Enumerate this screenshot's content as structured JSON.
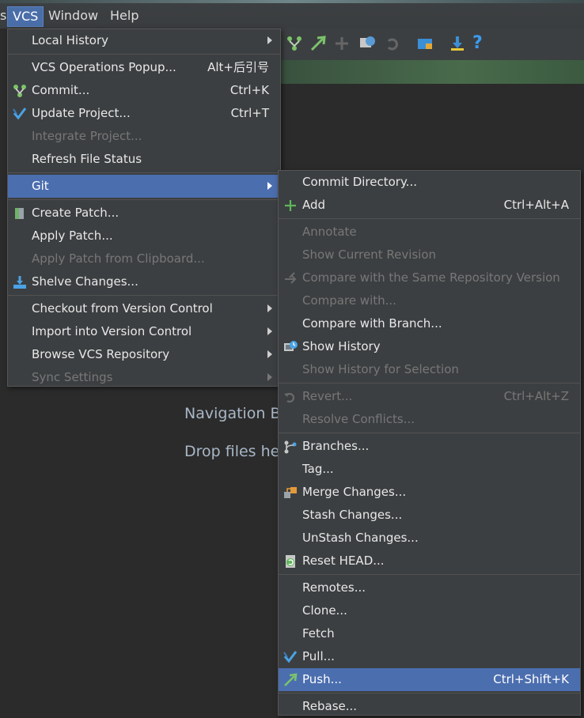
{
  "menubar": {
    "items": [
      {
        "label": "s"
      },
      {
        "label": "VCS"
      },
      {
        "label": "Window"
      },
      {
        "label": "Help"
      }
    ]
  },
  "editor": {
    "line1": "Navigation B",
    "line2": "Drop files he"
  },
  "vcs_menu": {
    "items": [
      {
        "label": "Local History",
        "arrow": true
      },
      {
        "label": "VCS Operations Popup...",
        "shortcut": "Alt+后引号"
      },
      {
        "label": "Commit...",
        "shortcut": "Ctrl+K",
        "icon": "commit-icon"
      },
      {
        "label": "Update Project...",
        "shortcut": "Ctrl+T",
        "icon": "update-project-icon"
      },
      {
        "label": "Integrate Project...",
        "disabled": true
      },
      {
        "label": "Refresh File Status"
      },
      {
        "label": "Git",
        "arrow": true,
        "selected": true
      },
      {
        "label": "Create Patch...",
        "icon": "create-patch-icon"
      },
      {
        "label": "Apply Patch..."
      },
      {
        "label": "Apply Patch from Clipboard...",
        "disabled": true
      },
      {
        "label": "Shelve Changes...",
        "icon": "shelve-icon"
      },
      {
        "label": "Checkout from Version Control",
        "arrow": true
      },
      {
        "label": "Import into Version Control",
        "arrow": true
      },
      {
        "label": "Browse VCS Repository",
        "arrow": true
      },
      {
        "label": "Sync Settings",
        "arrow": true,
        "disabled": true
      }
    ]
  },
  "git_menu": {
    "items": [
      {
        "label": "Commit Directory..."
      },
      {
        "label": "Add",
        "shortcut": "Ctrl+Alt+A",
        "icon": "add-icon"
      },
      {
        "label": "Annotate",
        "disabled": true
      },
      {
        "label": "Show Current Revision",
        "disabled": true
      },
      {
        "label": "Compare with the Same Repository Version",
        "disabled": true,
        "icon": "compare-icon"
      },
      {
        "label": "Compare with...",
        "disabled": true
      },
      {
        "label": "Compare with Branch..."
      },
      {
        "label": "Show History",
        "icon": "history-icon"
      },
      {
        "label": "Show History for Selection",
        "disabled": true
      },
      {
        "label": "Revert...",
        "shortcut": "Ctrl+Alt+Z",
        "disabled": true,
        "icon": "revert-icon"
      },
      {
        "label": "Resolve Conflicts...",
        "disabled": true
      },
      {
        "label": "Branches...",
        "icon": "branches-icon"
      },
      {
        "label": "Tag..."
      },
      {
        "label": "Merge Changes...",
        "icon": "merge-icon"
      },
      {
        "label": "Stash Changes..."
      },
      {
        "label": "UnStash Changes..."
      },
      {
        "label": "Reset HEAD...",
        "icon": "reset-head-icon"
      },
      {
        "label": "Remotes..."
      },
      {
        "label": "Clone..."
      },
      {
        "label": "Fetch"
      },
      {
        "label": "Pull...",
        "icon": "pull-icon"
      },
      {
        "label": "Push...",
        "shortcut": "Ctrl+Shift+K",
        "selected": true,
        "icon": "push-icon"
      },
      {
        "label": "Rebase..."
      }
    ]
  }
}
